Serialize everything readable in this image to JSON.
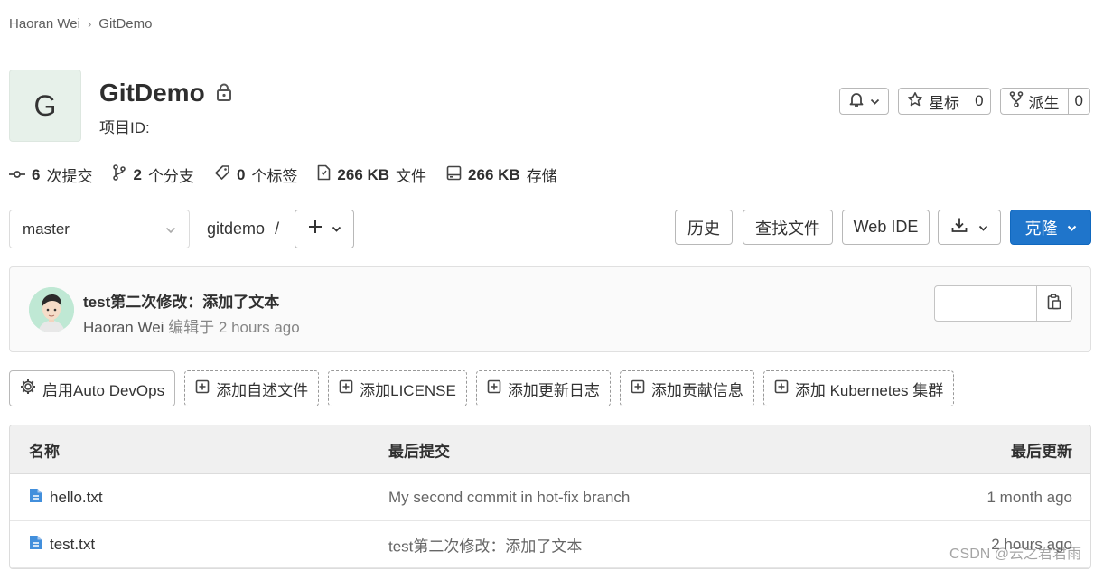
{
  "breadcrumb": {
    "user": "Haoran Wei",
    "project": "GitDemo"
  },
  "project": {
    "avatar_letter": "G",
    "title": "GitDemo",
    "id_label": "项目ID:"
  },
  "header_actions": {
    "star_label": "星标",
    "star_count": "0",
    "fork_label": "派生",
    "fork_count": "0"
  },
  "stats": {
    "commits_value": "6",
    "commits_label": "次提交",
    "branches_value": "2",
    "branches_label": "个分支",
    "tags_value": "0",
    "tags_label": "个标签",
    "files_value": "266 KB",
    "files_label": "文件",
    "storage_value": "266 KB",
    "storage_label": "存储"
  },
  "repo_nav": {
    "branch": "master",
    "path": "gitdemo",
    "path_sep": "/",
    "history": "历史",
    "find_file": "查找文件",
    "web_ide": "Web IDE",
    "clone": "克隆"
  },
  "last_commit": {
    "title": "test第二次修改：添加了文本",
    "author": "Haoran Wei",
    "action": "编辑于",
    "time": "2 hours ago"
  },
  "quick_actions": [
    "启用Auto DevOps",
    "添加自述文件",
    "添加LICENSE",
    "添加更新日志",
    "添加贡献信息",
    "添加 Kubernetes 集群"
  ],
  "table": {
    "headers": {
      "name": "名称",
      "last_commit": "最后提交",
      "last_update": "最后更新"
    },
    "rows": [
      {
        "name": "hello.txt",
        "commit": "My second commit in hot-fix branch",
        "updated": "1 month ago"
      },
      {
        "name": "test.txt",
        "commit": "test第二次修改：添加了文本",
        "updated": "2 hours ago"
      }
    ]
  },
  "watermark": "CSDN @云之君君雨",
  "colors": {
    "primary": "#1f75cb",
    "file_icon": "#428fdc",
    "avatar_bg": "#e7f1ea"
  }
}
